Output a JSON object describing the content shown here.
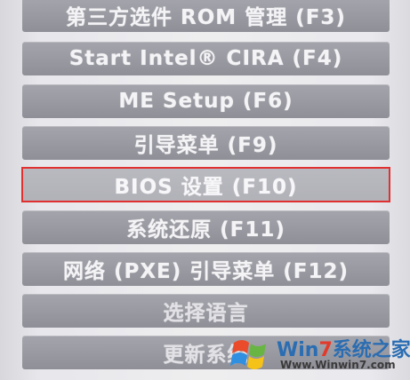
{
  "menu": {
    "items": [
      {
        "label": "第三方选件 ROM 管理 (F3)"
      },
      {
        "label": "Start Intel® CIRA (F4)"
      },
      {
        "label": "ME Setup (F6)"
      },
      {
        "label": "引导菜单 (F9)"
      },
      {
        "label": "BIOS 设置 (F10)"
      },
      {
        "label": "系统还原 (F11)"
      },
      {
        "label": "网络 (PXE) 引导菜单 (F12)"
      },
      {
        "label": "选择语言"
      },
      {
        "label": "更新系统"
      }
    ],
    "selected_index": 4
  },
  "colors": {
    "button": "#9c9ca4",
    "button_text": "#f4f4f6",
    "selection_border": "#e03030",
    "background": "#eeeeef"
  },
  "watermark": {
    "brand": "Win7系统之家",
    "brand_prefix": "Win",
    "brand_number": "7",
    "brand_suffix": "系统之家",
    "url": "Www.Winwin7.com"
  }
}
